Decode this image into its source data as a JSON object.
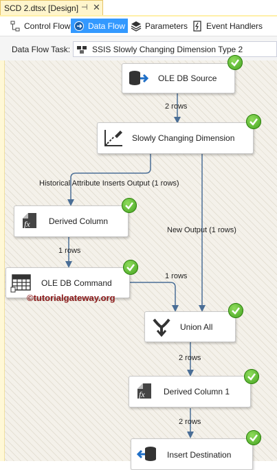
{
  "document_tab": {
    "title": "SCD 2.dtsx [Design]",
    "pin": "⊣",
    "close": "✕"
  },
  "toolbar": {
    "tabs": [
      {
        "label": "Control Flow",
        "icon": "control-flow-icon",
        "active": false
      },
      {
        "label": "Data Flow",
        "icon": "data-flow-icon",
        "active": true
      },
      {
        "label": "Parameters",
        "icon": "parameters-icon",
        "active": false
      },
      {
        "label": "Event Handlers",
        "icon": "event-handlers-icon",
        "active": false
      }
    ]
  },
  "task_bar": {
    "label": "Data Flow Task:",
    "selected": "SSIS Slowly Changing Dimension Type 2"
  },
  "components": {
    "ole_db_source": {
      "label": "OLE DB Source",
      "icon": "ole-db-source-icon",
      "status": "success"
    },
    "scd": {
      "label": "Slowly Changing Dimension",
      "icon": "scd-icon",
      "status": "success"
    },
    "derived_column": {
      "label": "Derived Column",
      "icon": "derived-column-icon",
      "status": "success"
    },
    "ole_db_command": {
      "label": "OLE DB Command",
      "icon": "ole-db-command-icon",
      "status": "success"
    },
    "union_all": {
      "label": "Union All",
      "icon": "union-all-icon",
      "status": "success"
    },
    "derived_column_1": {
      "label": "Derived Column 1",
      "icon": "derived-column-icon",
      "status": "success"
    },
    "insert_destination": {
      "label": "Insert Destination",
      "icon": "ole-db-destination-icon",
      "status": "success"
    }
  },
  "flows": {
    "src_to_scd": "2 rows",
    "historical": "Historical Attribute Inserts Output (1 rows)",
    "new_output": "New Output (1 rows)",
    "dc_to_cmd": "1 rows",
    "cmd_to_union": "1 rows",
    "union_to_dc1": "2 rows",
    "dc1_to_dest": "2 rows"
  },
  "watermark": "©tutorialgateway.org",
  "colors": {
    "active_tab": "#3399ff",
    "flow_line": "#4a6e96",
    "check": "#4caf20",
    "watermark": "#8b1a1a"
  }
}
